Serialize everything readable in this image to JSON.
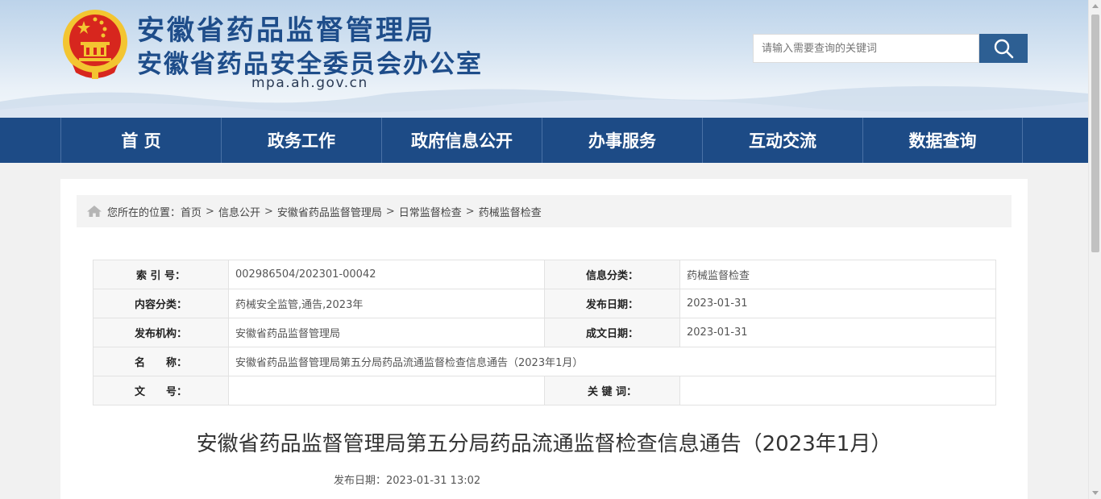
{
  "site": {
    "title_main": "安徽省药品监督管理局",
    "title_sub": "安徽省药品安全委员会办公室",
    "domain": "mpa.ah.gov.cn"
  },
  "search": {
    "placeholder": "请输入需要查询的关键词",
    "icon": "search-icon"
  },
  "nav": {
    "items": [
      "首 页",
      "政务工作",
      "政府信息公开",
      "办事服务",
      "互动交流",
      "数据查询"
    ]
  },
  "breadcrumb": {
    "prefix": "您所在的位置：",
    "icon": "home-icon",
    "items": [
      "首页",
      "信息公开",
      "安徽省药品监督管理局",
      "日常监督检查",
      "药械监督检查"
    ],
    "separator": ">"
  },
  "info": {
    "index_label": "索 引 号：",
    "index_value": "002986504/202301-00042",
    "category_label": "信息分类：",
    "category_value": "药械监督检查",
    "content_label": "内容分类：",
    "content_value": "药械安全监管,通告,2023年",
    "publish_date_label": "发布日期：",
    "publish_date_value": "2023-01-31",
    "org_label": "发布机构：",
    "org_value": "安徽省药品监督管理局",
    "created_label": "成文日期：",
    "created_value": "2023-01-31",
    "name_label": "名　　称：",
    "name_value": "安徽省药品监督管理局第五分局药品流通监督检查信息通告（2023年1月）",
    "doc_no_label": "文　　号：",
    "doc_no_value": "",
    "keywords_label": "关 键 词：",
    "keywords_value": ""
  },
  "article": {
    "title": "安徽省药品监督管理局第五分局药品流通监督检查信息通告（2023年1月）",
    "date": "发布日期：2023-01-31 13:02"
  },
  "colors": {
    "brand_blue": "#1d4b86",
    "title_blue": "#1e4d8a",
    "search_button": "#2d5f93",
    "emblem_red": "#d7261e",
    "emblem_gold": "#f3c531"
  }
}
